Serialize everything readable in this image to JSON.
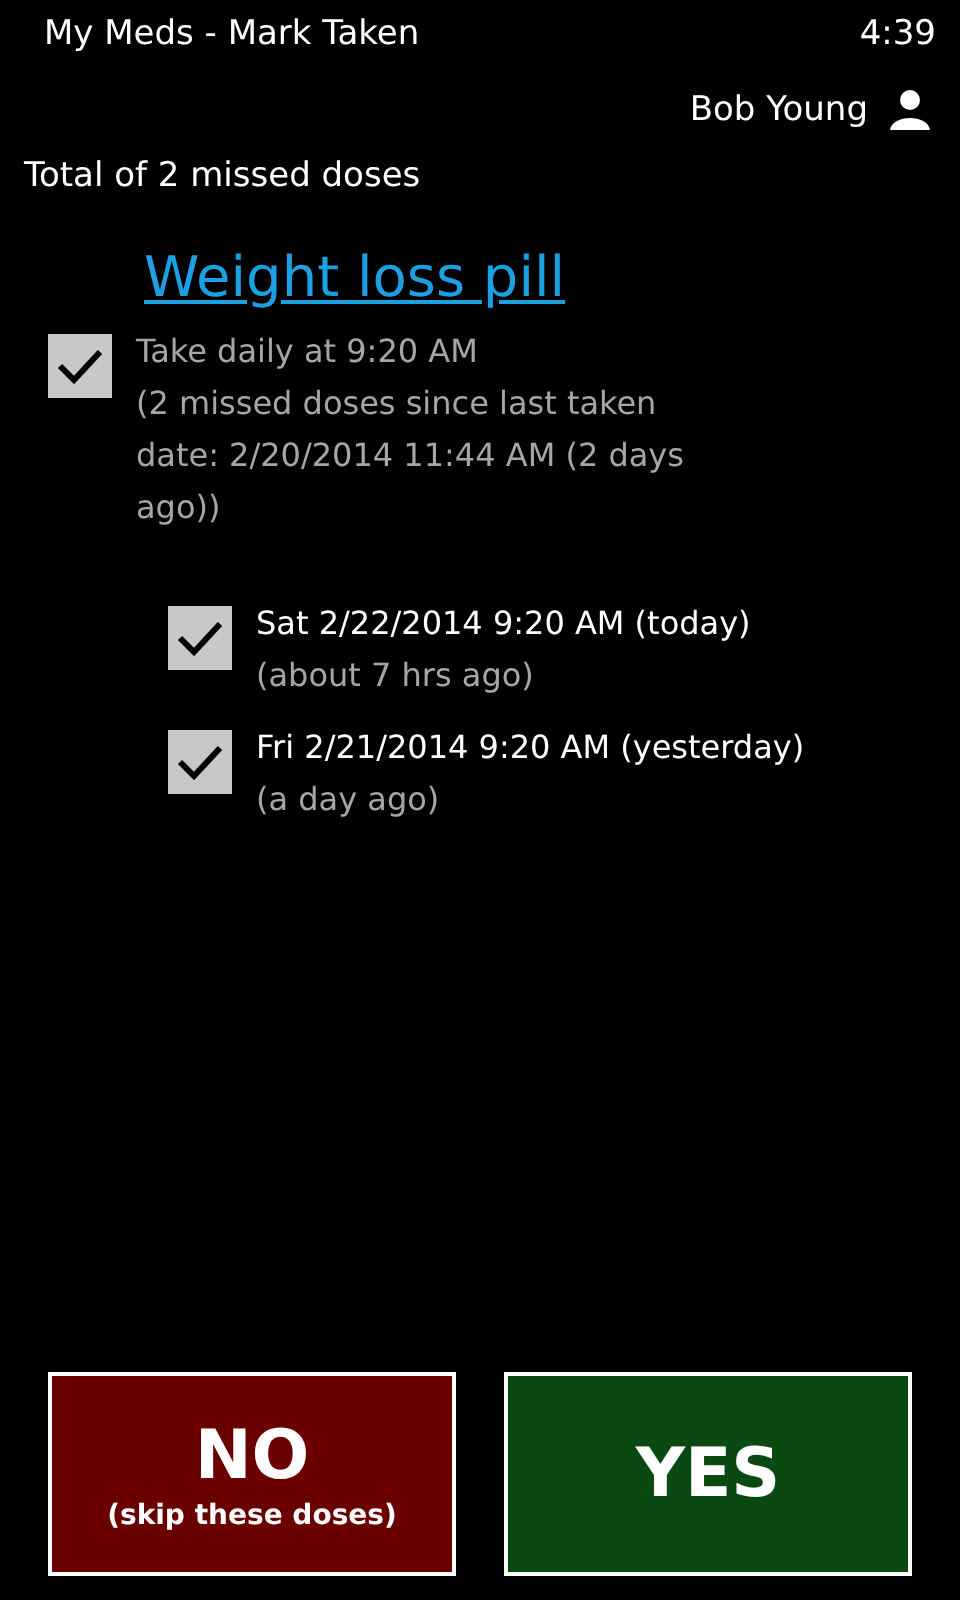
{
  "status_bar": {
    "title": "My Meds - Mark Taken",
    "time": "4:39"
  },
  "user": {
    "name": "Bob Young"
  },
  "summary": "Total of 2 missed doses",
  "medication": {
    "name": "Weight loss pill",
    "checked": true,
    "schedule": "Take daily at 9:20 AM",
    "details": "(2 missed doses since last taken date: 2/20/2014 11:44 AM (2 days ago))",
    "doses": [
      {
        "date": "Sat 2/22/2014 9:20 AM (today)",
        "ago": "(about 7 hrs ago)",
        "checked": true
      },
      {
        "date": "Fri 2/21/2014 9:20 AM (yesterday)",
        "ago": "(a day ago)",
        "checked": true
      }
    ]
  },
  "buttons": [
    {
      "kind": "no",
      "label": "NO",
      "sublabel": "(skip these doses)"
    },
    {
      "kind": "yes",
      "label": "YES"
    }
  ]
}
